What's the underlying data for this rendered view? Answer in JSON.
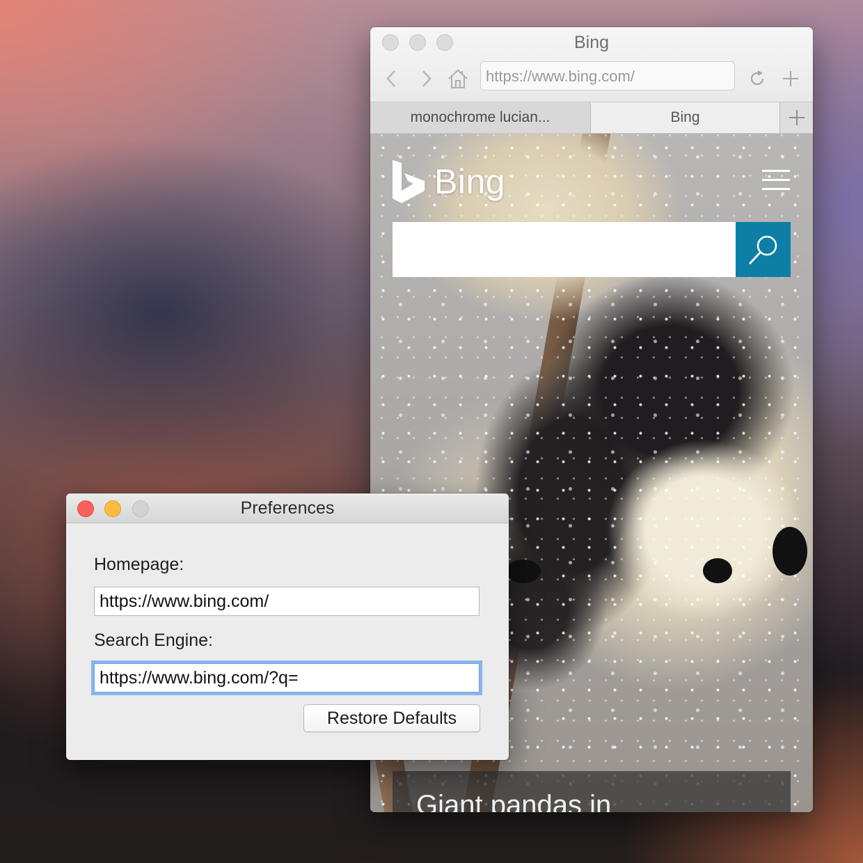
{
  "browser": {
    "title": "Bing",
    "url": "https://www.bing.com/",
    "tabs": [
      {
        "label": "monochrome lucian...",
        "active": false
      },
      {
        "label": "Bing",
        "active": true
      }
    ]
  },
  "bing_page": {
    "logo_text": "Bing",
    "search_value": "",
    "caption": "Giant pandas in",
    "accent_color": "#0d7ea6"
  },
  "preferences": {
    "title": "Preferences",
    "homepage_label": "Homepage:",
    "homepage_value": "https://www.bing.com/",
    "search_engine_label": "Search Engine:",
    "search_engine_value": "https://www.bing.com/?q=",
    "restore_button": "Restore Defaults"
  }
}
